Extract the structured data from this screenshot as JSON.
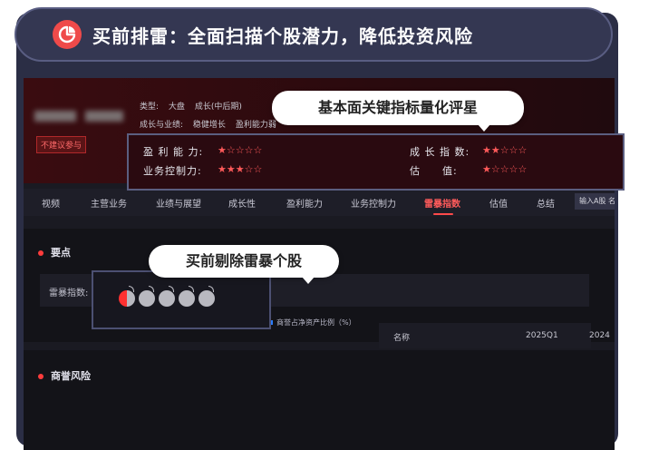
{
  "banner": {
    "text": "买前排雷：全面扫描个股潜力，降低投资风险"
  },
  "stock_header": {
    "badge": "不建议参与",
    "type_label": "类型:",
    "type_values": [
      "大盘",
      "成长(中后期)"
    ],
    "growth_label": "成长与业绩:",
    "growth_values": [
      "稳健增长",
      "盈利能力弱"
    ]
  },
  "tips": {
    "rating_tip": "基本面关键指标量化评星",
    "thunder_tip": "买前剔除雷暴个股"
  },
  "ratings": [
    {
      "label": "盈 利 能 力:",
      "stars": "★☆☆☆☆",
      "value": 0.5
    },
    {
      "label": "业务控制力:",
      "stars": "★★★☆☆",
      "value": 3
    },
    {
      "label": "成 长 指 数:",
      "stars": "★★☆☆☆",
      "value": 1.5
    },
    {
      "label": "估　　值:",
      "stars": "★☆☆☆☆",
      "value": 1
    }
  ],
  "tabs": [
    "视频",
    "主营业务",
    "业绩与展望",
    "成长性",
    "盈利能力",
    "业务控制力",
    "雷暴指数",
    "估值",
    "总结"
  ],
  "active_tab": "雷暴指数",
  "search_placeholder": "输入A股 名",
  "section_key_points": "要点",
  "thunder_label": "雷暴指数:",
  "thunder_value": 0.5,
  "section_goodwill": "商誉风险",
  "legend_label": "商誉占净资产比例（%）",
  "table_headers": [
    "名称",
    "2025Q1",
    "2024"
  ],
  "colors": {
    "accent": "#ff4a4a",
    "banner_bg": "#343752",
    "frame_bg": "#2b2e45"
  }
}
